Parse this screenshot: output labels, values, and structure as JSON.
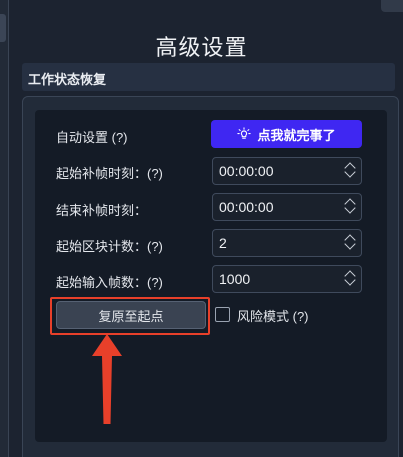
{
  "page": {
    "title": "高级设置"
  },
  "section": {
    "title": "工作状态恢复"
  },
  "colors": {
    "accent": "#3f27f2",
    "highlight": "#e8402a"
  },
  "form": {
    "auto_setting": {
      "label": "自动设置 (?)",
      "button_label": "点我就完事了",
      "button_icon": "lightbulb-icon"
    },
    "start_interp_time": {
      "label": "起始补帧时刻：(?)",
      "value": "00:00:00"
    },
    "end_interp_time": {
      "label": "结束补帧时刻：",
      "value": "00:00:00"
    },
    "start_chunk_count": {
      "label": "起始区块计数：(?)",
      "value": "2"
    },
    "start_input_frame": {
      "label": "起始输入帧数：(?)",
      "value": "1000"
    },
    "reset_button": {
      "label": "复原至起点"
    },
    "risk_mode": {
      "label": "风险模式 (?)",
      "checked": false
    }
  },
  "annotation": {
    "arrow_icon": "red-up-arrow-icon"
  }
}
